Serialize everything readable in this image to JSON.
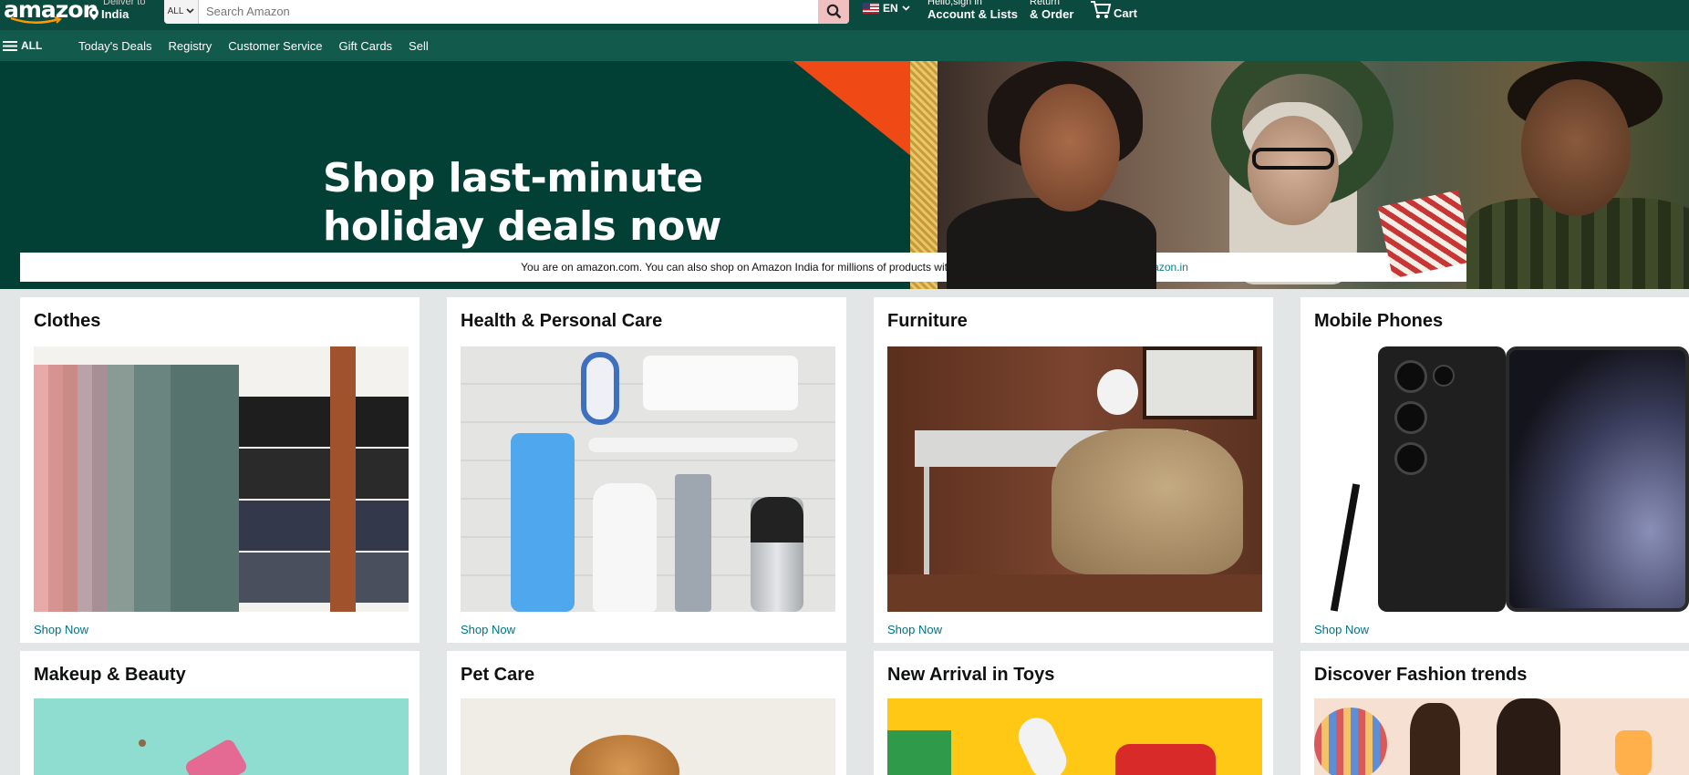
{
  "header": {
    "logo_text": "amazon",
    "deliver_small": "Deliver to",
    "deliver_location": "India",
    "search_category": "ALL",
    "search_placeholder": "Search Amazon",
    "language": "EN",
    "account_small": "Hello,sign in",
    "account_big": "Account & Lists",
    "returns_small": "Return",
    "returns_big": "& Order",
    "cart_label": "Cart"
  },
  "subnav": {
    "all_label": "ALL",
    "links": [
      "Today's Deals",
      "Registry",
      "Customer Service",
      "Gift Cards",
      "Sell"
    ]
  },
  "hero": {
    "title_line1": "Shop last-minute",
    "title_line2": "holiday deals now"
  },
  "notice": {
    "text": "You are on amazon.com. You can also shop on Amazon India for millions of products with fast local delivery.",
    "link": "Click here to go to amazon.in"
  },
  "cards": [
    {
      "title": "Clothes",
      "link": "Shop Now"
    },
    {
      "title": "Health & Personal Care",
      "link": "Shop Now"
    },
    {
      "title": "Furniture",
      "link": "Shop Now"
    },
    {
      "title": "Mobile Phones",
      "link": "Shop Now"
    },
    {
      "title": "Makeup & Beauty"
    },
    {
      "title": "Pet Care"
    },
    {
      "title": "New Arrival in Toys"
    },
    {
      "title": "Discover Fashion trends"
    }
  ],
  "colors": {
    "nav_top": "#0b4a3e",
    "nav_sub": "#125a4b",
    "hero_bg": "#024035",
    "link": "#007185"
  },
  "icons": [
    "location-pin-icon",
    "chevron-down-icon",
    "search-icon",
    "us-flag-icon",
    "cart-icon",
    "hamburger-icon"
  ]
}
